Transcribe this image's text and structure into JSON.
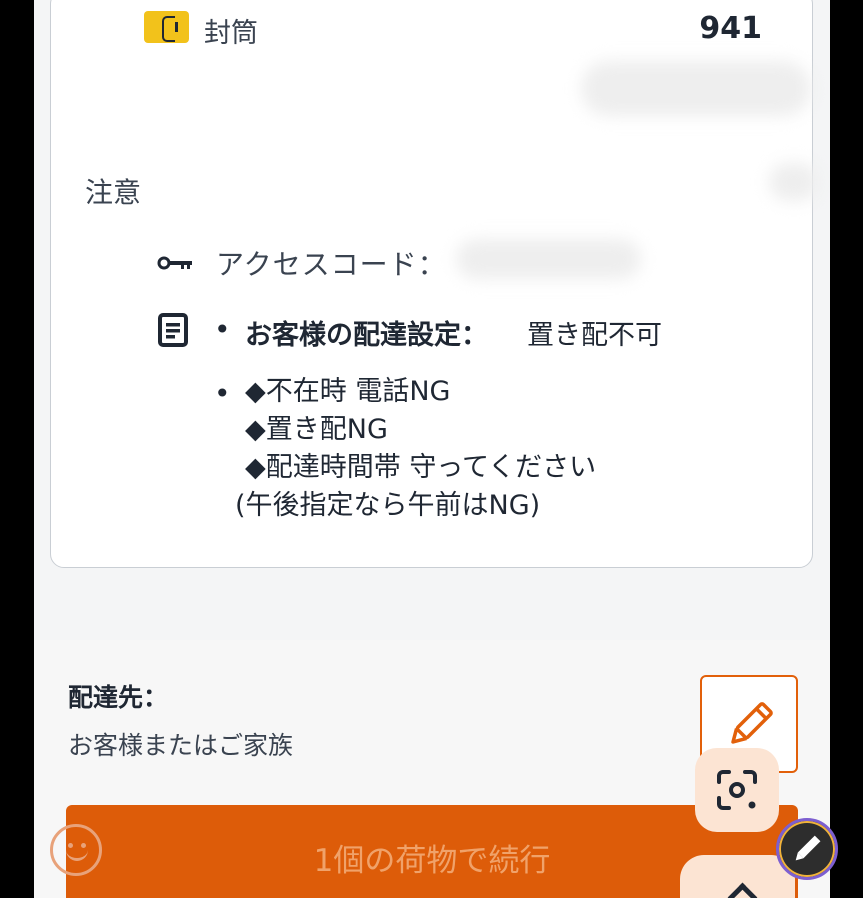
{
  "package": {
    "type_label": "封筒",
    "count": "941",
    "icon": "envelope-icon"
  },
  "notes": {
    "title": "注意",
    "access_code_label": "アクセスコード：",
    "delivery_pref_label": "お客様の配達設定：",
    "delivery_pref_value": "置き配不可",
    "bullet": "•",
    "customer_notes": [
      "◆不在時 電話NG",
      "◆置き配NG",
      "◆配達時間帯 守ってください",
      "(午後指定なら午前はNG)"
    ]
  },
  "destination": {
    "label": "配達先：",
    "value": "お客様またはご家族"
  },
  "actions": {
    "continue_label": "1個の荷物で続行"
  },
  "colors": {
    "accent": "#dd5c09",
    "package_icon": "#f2c21b",
    "text": "#1f2733"
  }
}
